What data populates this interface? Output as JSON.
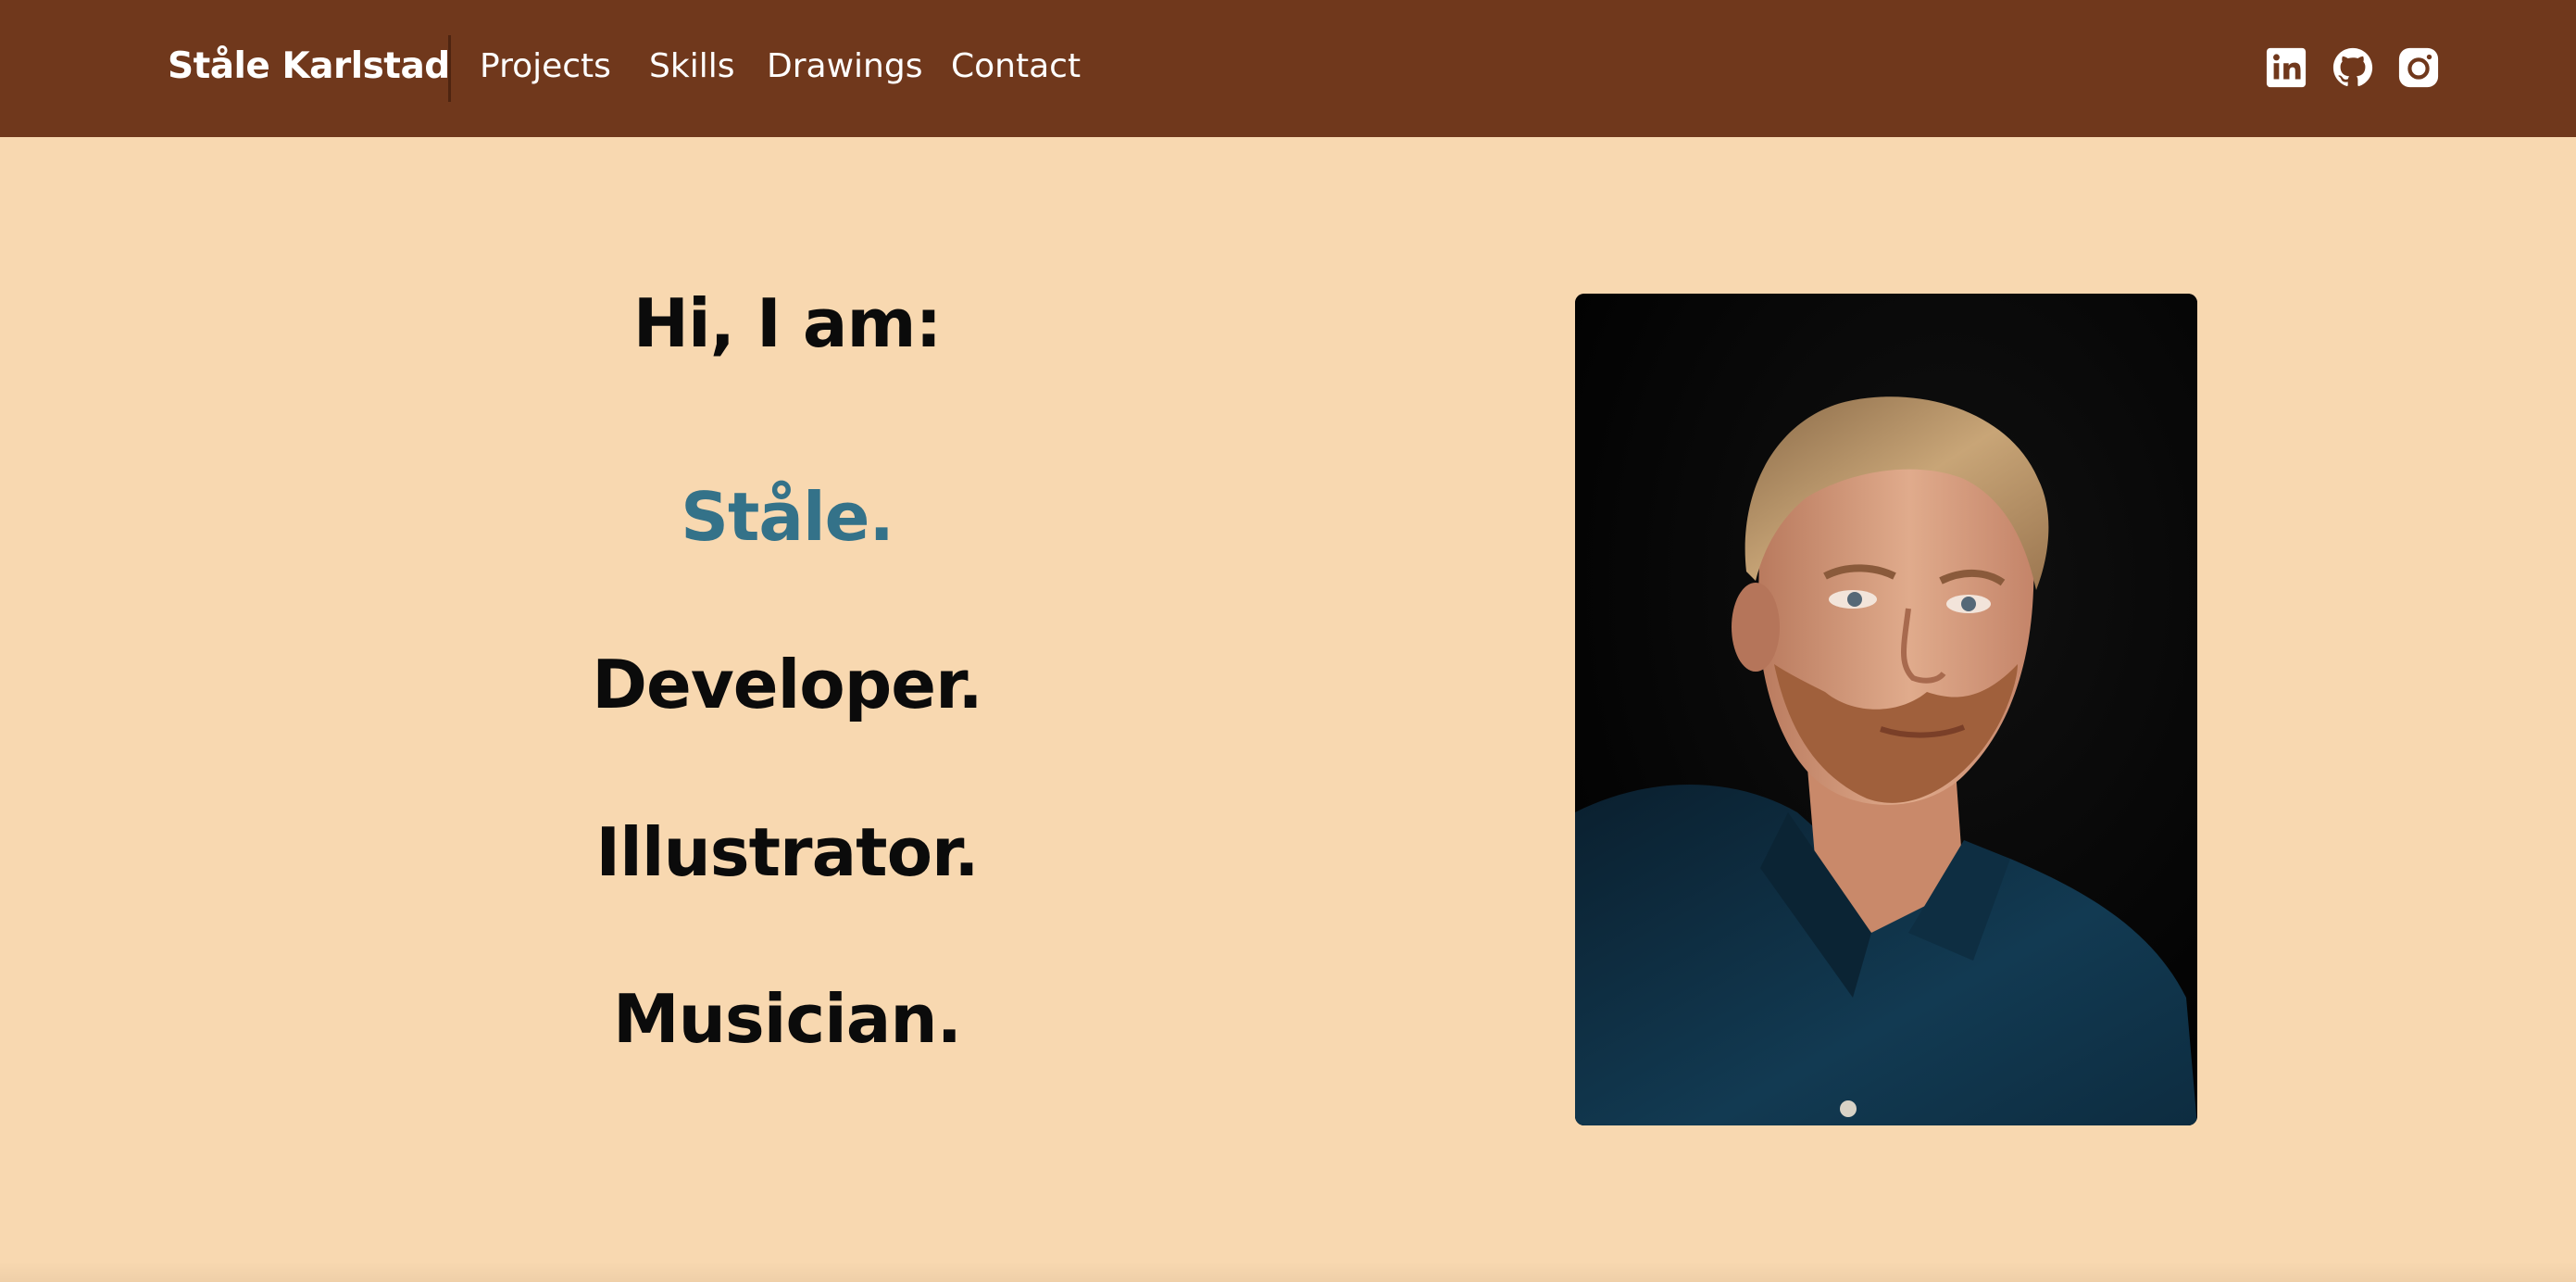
{
  "nav": {
    "brand": "Ståle Karlstad",
    "links": [
      "Projects",
      "Skills",
      "Drawings",
      "Contact"
    ],
    "social_icons": [
      "linkedin-icon",
      "github-icon",
      "instagram-icon"
    ]
  },
  "intro": {
    "greeting": "Hi, I am:",
    "name": "Ståle.",
    "roles": [
      "Developer.",
      "Illustrator.",
      "Musician."
    ]
  },
  "colors": {
    "navbar": "#70381c",
    "page_background": "#f8d8b0",
    "name_accent": "#347289",
    "heading_text": "#0b0b0b"
  }
}
